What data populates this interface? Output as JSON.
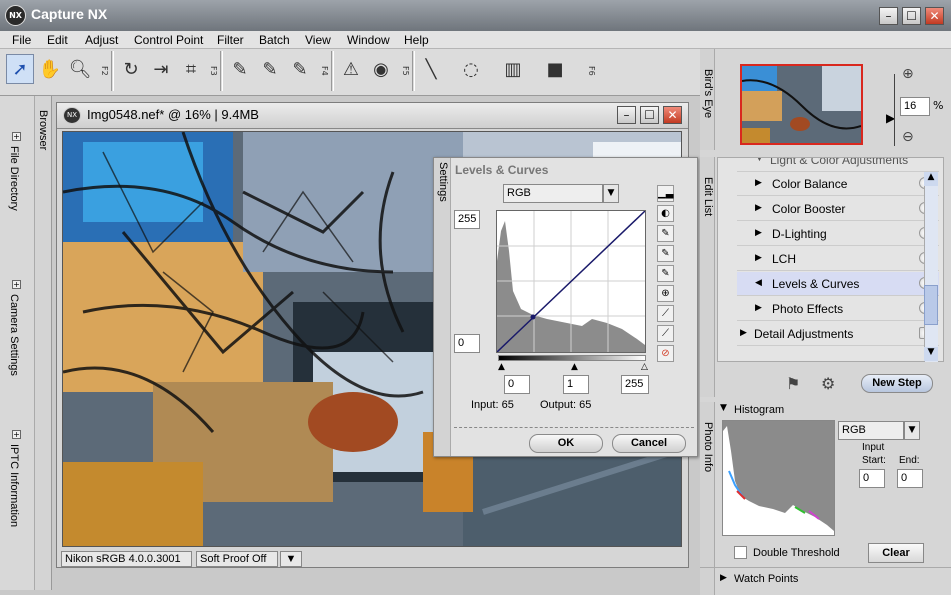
{
  "window": {
    "title": "Capture NX",
    "app_icon": "NX"
  },
  "menu": [
    "File",
    "Edit",
    "Adjust",
    "Control Point",
    "Filter",
    "Batch",
    "View",
    "Window",
    "Help"
  ],
  "toolbar": {
    "fkeys": [
      "F2",
      "F3",
      "F4",
      "F5",
      "F6"
    ]
  },
  "left_panels": [
    {
      "label": "File Directory"
    },
    {
      "label": "Camera Settings"
    },
    {
      "label": "IPTC Information"
    }
  ],
  "browser_tab": "Browser",
  "document": {
    "title": "Img0548.nef* @ 16% | 9.4MB",
    "profile": "Nikon sRGB 4.0.0.3001",
    "proof": "Soft Proof Off"
  },
  "levels": {
    "title": "Levels & Curves",
    "channel": "RGB",
    "top_value": "255",
    "bottom_value": "0",
    "black": "0",
    "gamma": "1",
    "white": "255",
    "input_label": "Input: 65",
    "output_label": "Output: 65",
    "ok": "OK",
    "cancel": "Cancel",
    "settings_tab": "Settings"
  },
  "birdseye": {
    "tab": "Bird's Eye",
    "zoom": "16",
    "zoom_unit": "%"
  },
  "edit_list": {
    "tab": "Edit List",
    "header": "Light & Color Adjustments",
    "items": [
      "Color Balance",
      "Color Booster",
      "D-Lighting",
      "LCH",
      "Levels & Curves",
      "Photo Effects"
    ],
    "detail": "Detail Adjustments",
    "new_step": "New Step",
    "selected_index": 4
  },
  "photo_info": {
    "tab": "Photo Info",
    "histogram_title": "Histogram",
    "channel": "RGB",
    "input_label": "Input",
    "start_label": "Start:",
    "end_label": "End:",
    "start_value": "0",
    "end_value": "0",
    "double_threshold": "Double Threshold",
    "clear": "Clear",
    "watch_points": "Watch Points"
  },
  "colors": {
    "accent_selected": "#d7dcf3",
    "close_red": "#d23b25",
    "curve_line": "#1a1a6a"
  }
}
